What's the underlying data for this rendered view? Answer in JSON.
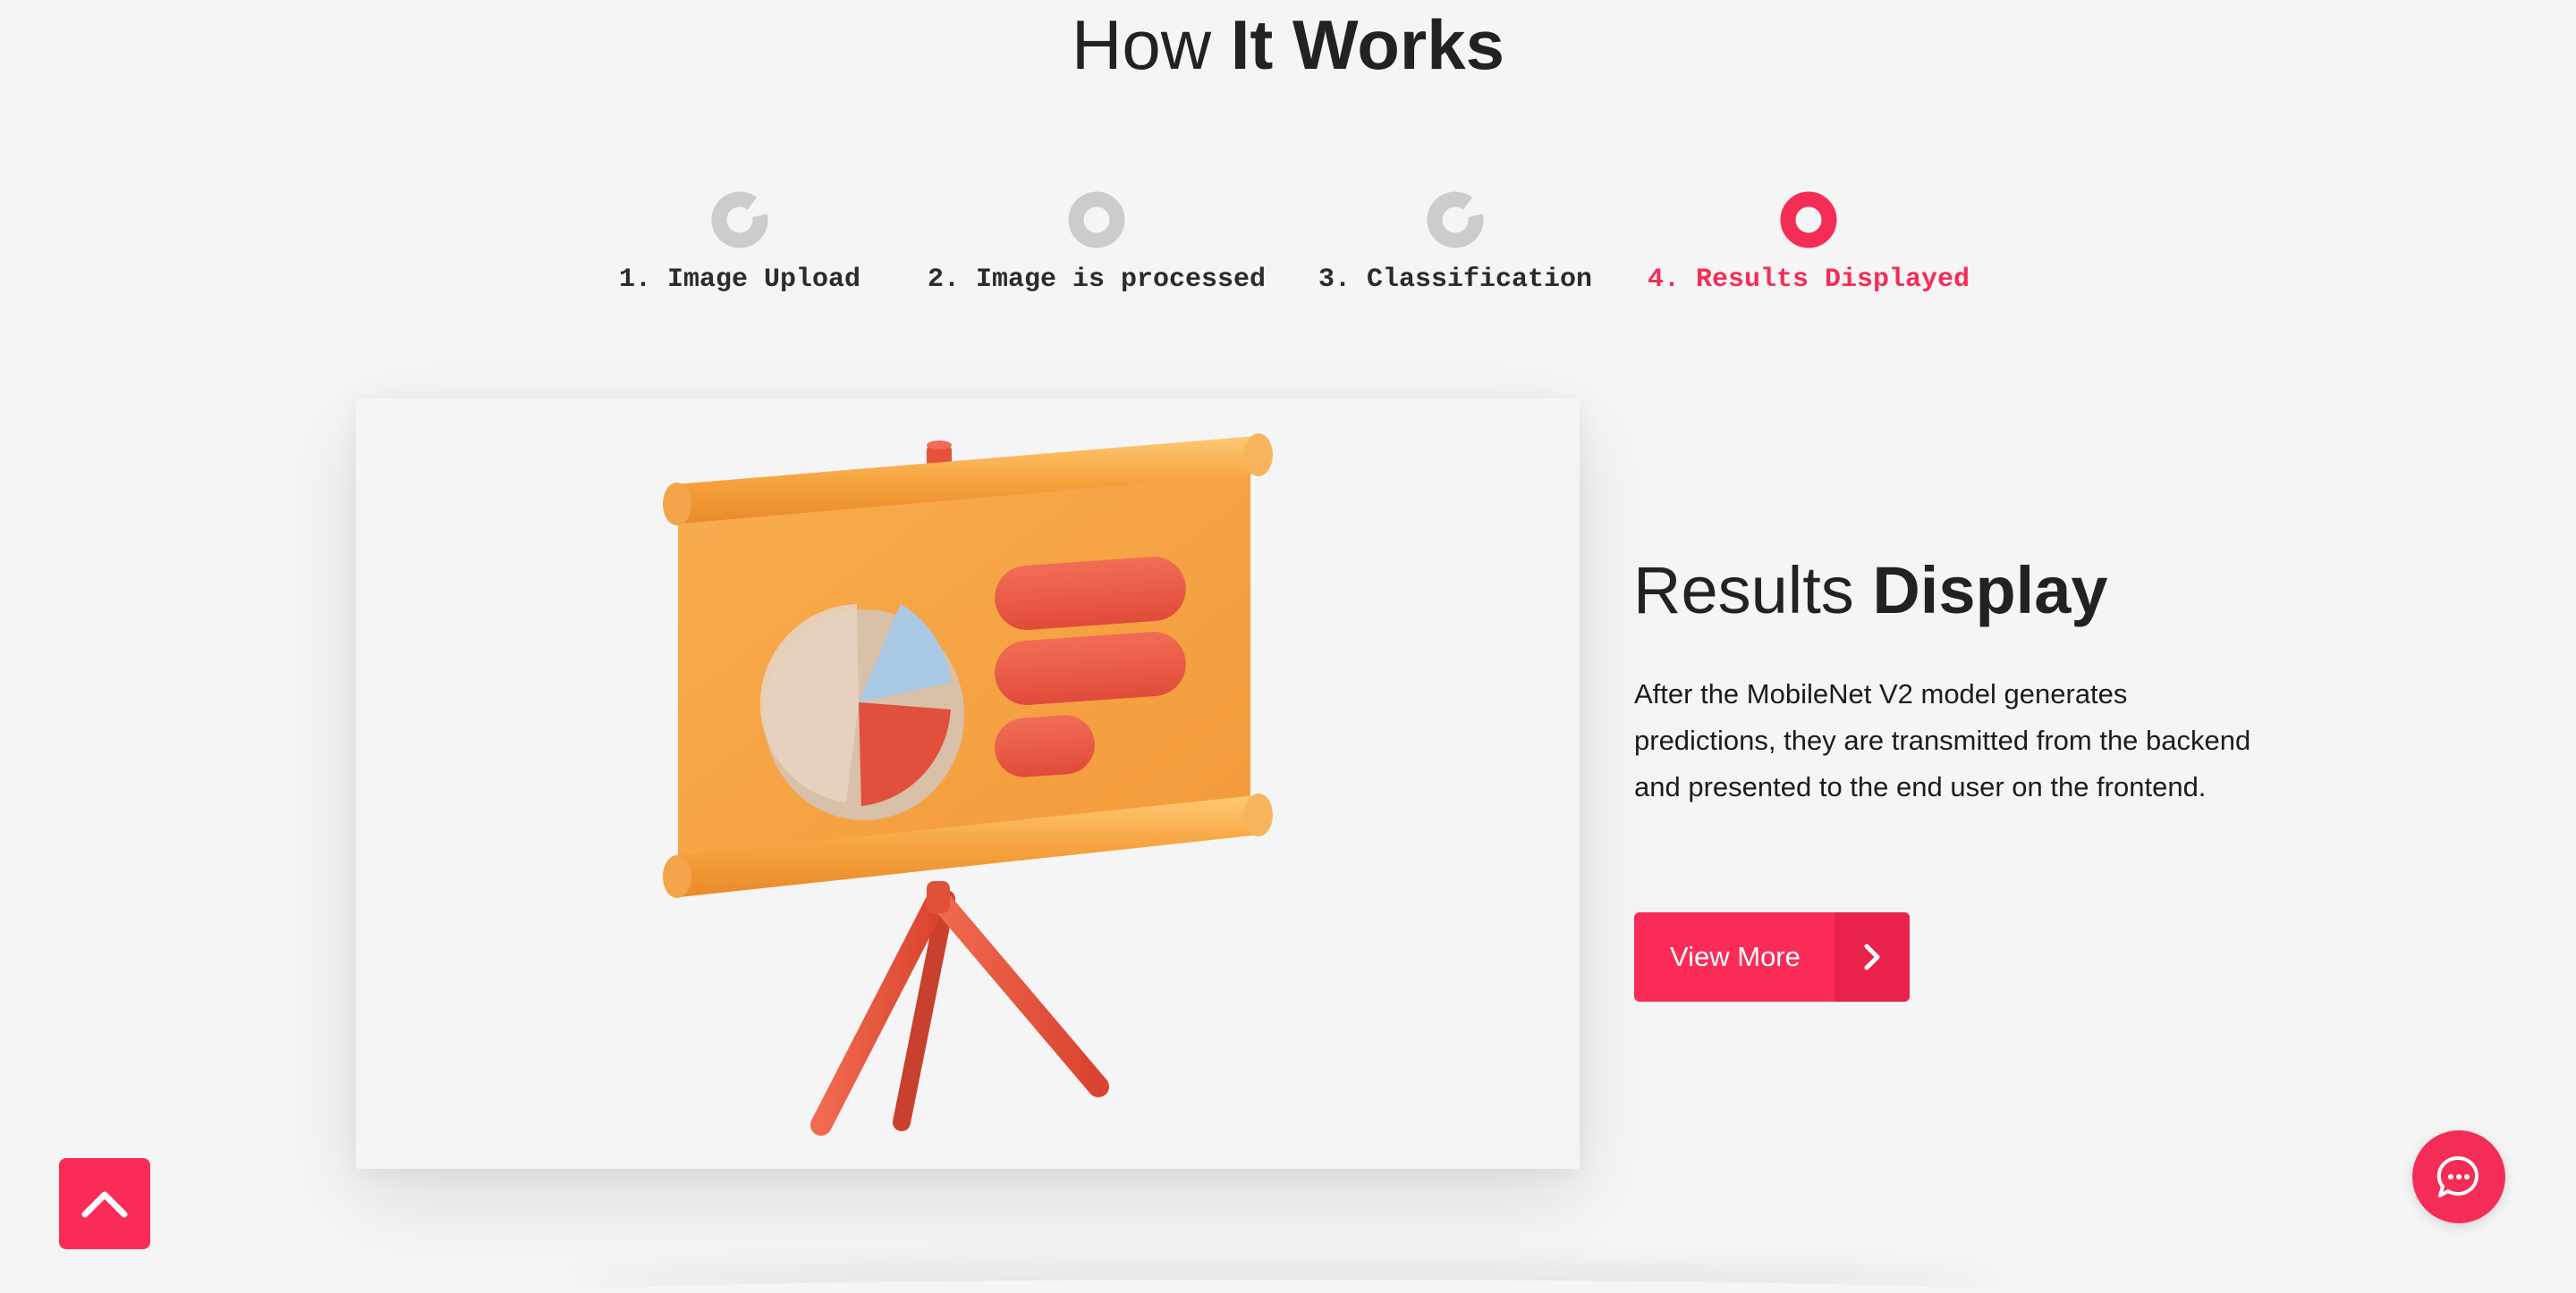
{
  "header": {
    "title_light": "How",
    "title_bold": "It Works"
  },
  "steps": [
    {
      "label": "1. Image Upload",
      "active": false
    },
    {
      "label": "2. Image is processed",
      "active": false
    },
    {
      "label": "3. Classification",
      "active": false
    },
    {
      "label": "4. Results Displayed",
      "active": true
    }
  ],
  "content": {
    "title_light": "Results",
    "title_bold": "Display",
    "description": "After the MobileNet V2 model generates predictions, they are transmitted from the backend and presented to the end user on the frontend.",
    "button_label": "View More"
  },
  "icons": {
    "illustration": "presentation-board-pie-chart",
    "step_inactive": "ring-indicator-gray",
    "step_active": "ring-indicator-pink",
    "button_arrow": "chevron-right-icon",
    "back_to_top": "chevron-up-icon",
    "chat": "chat-bubble-icon"
  },
  "colors": {
    "accent": "#fa2c57",
    "accent_dark": "#e9224c",
    "inactive_step": "#cccccc",
    "background": "#f5f5f5",
    "text": "#222222"
  }
}
